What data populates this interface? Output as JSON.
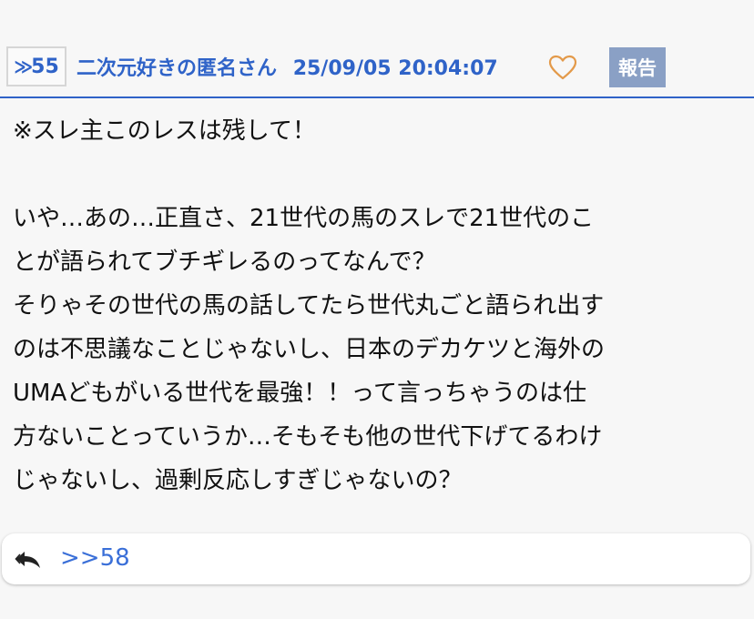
{
  "header": {
    "res_number": "55",
    "res_prefix": "≫",
    "author": "二次元好きの匿名さん",
    "timestamp": "25/09/05 20:04:07",
    "like_icon": "heart-outline-icon",
    "report_label": "報告"
  },
  "body": {
    "lines": [
      "※スレ主このレスは残して！",
      "",
      "いや…あの…正直さ、21世代の馬のスレで21世代のこ",
      "とが語られてブチギレるのってなんで？",
      "そりゃその世代の馬の話してたら世代丸ごと語られ出す",
      "のは不思議なことじゃないし、日本のデカケツと海外の",
      "UMAどもがいる世代を最強！！って言っちゃうのは仕",
      "方ないことっていうか…そもそも他の世代下げてるわけ",
      "じゃないし、過剰反応しすぎじゃないの？"
    ]
  },
  "reply": {
    "icon": "reply-arrow-icon",
    "link_text": ">>58"
  },
  "colors": {
    "accent": "#2f63c8",
    "report_bg": "#8aa0c5",
    "heart": "#e39a4a",
    "background": "#f7f7f7"
  }
}
